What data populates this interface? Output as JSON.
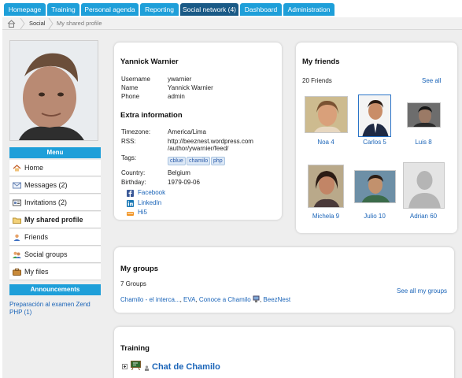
{
  "nav": {
    "tabs": [
      {
        "label": "Homepage"
      },
      {
        "label": "Training"
      },
      {
        "label": "Personal agenda"
      },
      {
        "label": "Reporting"
      },
      {
        "label": "Social network (4)"
      },
      {
        "label": "Dashboard"
      },
      {
        "label": "Administration"
      }
    ],
    "active_index": 4
  },
  "breadcrumb": {
    "home_icon": "home-icon",
    "items": [
      "Social",
      "My shared profile"
    ]
  },
  "sidebar": {
    "menu_title": "Menu",
    "items": [
      {
        "label": "Home",
        "icon": "home-icon"
      },
      {
        "label": "Messages (2)",
        "icon": "envelope-icon"
      },
      {
        "label": "Invitations (2)",
        "icon": "invitation-icon"
      },
      {
        "label": "My shared profile",
        "icon": "folder-icon"
      },
      {
        "label": "Friends",
        "icon": "user-icon"
      },
      {
        "label": "Social groups",
        "icon": "group-icon"
      },
      {
        "label": "My files",
        "icon": "files-icon"
      }
    ],
    "announcements_title": "Announcements",
    "announcement_link": "Preparación al examen Zend PHP (1)"
  },
  "profile": {
    "name_heading": "Yannick Warnier",
    "fields": [
      {
        "key": "Username",
        "value": "ywarnier"
      },
      {
        "key": "Name",
        "value": "Yannick Warnier"
      },
      {
        "key": "Phone",
        "value": "admin"
      }
    ],
    "extra_title": "Extra information",
    "timezone_key": "Timezone:",
    "timezone_value": "America/Lima",
    "rss_key": "RSS:",
    "rss_line1": "http://beeznest.wordpress.com",
    "rss_line2": "/author/ywarnier/feed/",
    "tags_key": "Tags:",
    "tags": [
      "cblue",
      "chamilo",
      "php"
    ],
    "country_key": "Country:",
    "country_value": "Belgium",
    "birthday_key": "Birthday:",
    "birthday_value": "1979-09-06",
    "socials": [
      {
        "label": "Facebook",
        "icon": "facebook-icon"
      },
      {
        "label": "LinkedIn",
        "icon": "linkedin-icon"
      },
      {
        "label": "Hi5",
        "icon": "hi5-icon"
      }
    ]
  },
  "friends": {
    "title": "My friends",
    "count_label": "20 Friends",
    "see_all": "See all",
    "list": [
      {
        "name": "Noa 4"
      },
      {
        "name": "Carlos 5"
      },
      {
        "name": "Luis 8"
      },
      {
        "name": "Michela 9"
      },
      {
        "name": "Julio 10"
      },
      {
        "name": "Adrian 60"
      }
    ]
  },
  "groups": {
    "title": "My groups",
    "count_label": "7 Groups",
    "group1": "Chamilo - el interca...",
    "group2": "EVA",
    "group3": "Conoce a Chamilo",
    "group4": "BeezNest",
    "sep1": ", ",
    "sep2": ", ",
    "sep3": ", ",
    "see_all": "See all my groups"
  },
  "training": {
    "title": "Training",
    "course": "Chat de Chamilo"
  },
  "colors": {
    "tab_blue": "#1e9fd9",
    "tab_active": "#1a5a86",
    "link": "#1a64b8",
    "panel_bg": "#eeeeee"
  }
}
